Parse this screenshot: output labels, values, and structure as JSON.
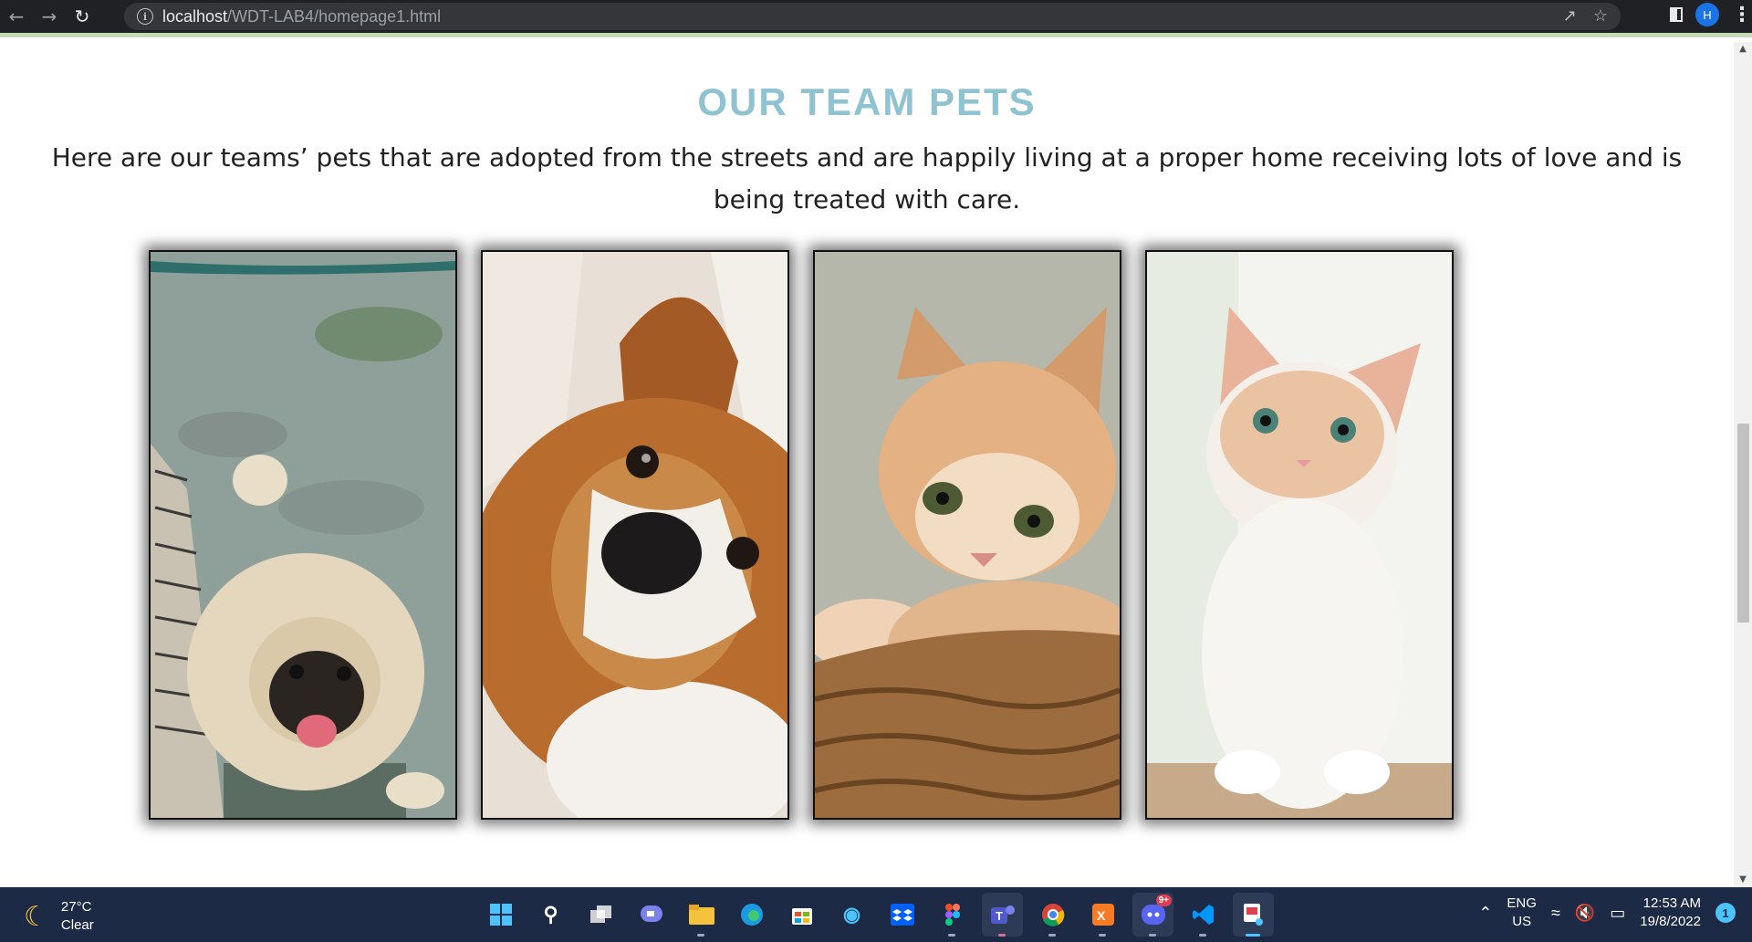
{
  "browser": {
    "url_host": "localhost",
    "url_path": "/WDT-LAB4/homepage1.html",
    "profile_initial": "H"
  },
  "page": {
    "title": "OUR TEAM PETS",
    "description": "Here are our teams’ pets that are adopted from the streets and are happily living at a proper home receiving lots of love and is being treated with care."
  },
  "taskbar": {
    "weather_temp": "27°C",
    "weather_condition": "Clear",
    "lang_line1": "ENG",
    "lang_line2": "US",
    "time": "12:53 AM",
    "date": "19/8/2022",
    "notification_count": "1",
    "discord_badge": "9+"
  }
}
